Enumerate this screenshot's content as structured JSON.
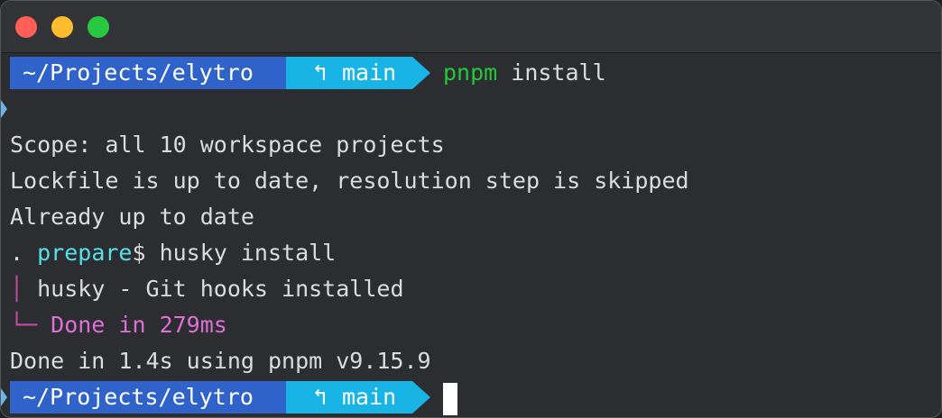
{
  "window": {
    "traffic_lights": [
      "close",
      "minimize",
      "zoom"
    ]
  },
  "prompt": {
    "path": "~/Projects/elytro",
    "branch_icon": "↰",
    "branch": "main"
  },
  "command": {
    "program": "pnpm",
    "args": " install"
  },
  "output": {
    "scope": "Scope: all 10 workspace projects",
    "lockfile": "Lockfile is up to date, resolution step is skipped",
    "already": "Already up to date",
    "prepare_dot": ". ",
    "prepare_script": "prepare",
    "prepare_cmd": "$ husky install",
    "tree_pipe": "│ ",
    "husky_msg": "husky - Git hooks installed",
    "tree_end": "└─ ",
    "done_prepare": "Done in 279ms",
    "done_total": "Done in 1.4s using pnpm v9.15.9"
  },
  "colors": {
    "path_bg": "#2f63c9",
    "branch_bg": "#19b4e6",
    "command_green": "#25c63b",
    "script_cyan": "#58e0e8",
    "done_pink": "#df6fd6"
  }
}
